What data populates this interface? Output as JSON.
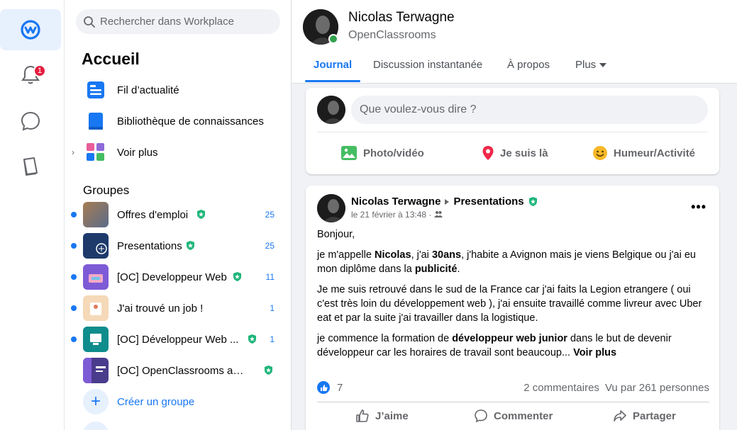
{
  "rail": {
    "notifications_badge": "1"
  },
  "sidebar": {
    "search_placeholder": "Rechercher dans Workplace",
    "title": "Accueil",
    "nav": [
      {
        "label": "Fil d’actualité",
        "icon": "news-feed-icon"
      },
      {
        "label": "Bibliothèque de connaissances",
        "icon": "knowledge-library-icon"
      },
      {
        "label": "Voir plus",
        "icon": "see-more-icon"
      }
    ],
    "groups_title": "Groupes",
    "groups": [
      {
        "name": "Offres d'emploi",
        "count": "25",
        "unread": true
      },
      {
        "name": "Presentations",
        "count": "25",
        "unread": true
      },
      {
        "name": "[OC] Developpeur Web",
        "count": "11",
        "unread": true
      },
      {
        "name": "J'ai trouvé un job !",
        "count": "1",
        "unread": true
      },
      {
        "name": "[OC] Développeur Web ...",
        "count": "1",
        "unread": true
      },
      {
        "name": "[OC] OpenClassrooms anno...",
        "count": "",
        "unread": false
      }
    ],
    "create_group": "Créer un groupe"
  },
  "profile": {
    "name": "Nicolas Terwagne",
    "org": "OpenClassrooms",
    "tabs": [
      "Journal",
      "Discussion instantanée",
      "À propos",
      "Plus"
    ]
  },
  "composer": {
    "placeholder": "Que voulez-vous dire ?",
    "actions": [
      "Photo/vidéo",
      "Je suis là",
      "Humeur/Activité"
    ]
  },
  "post": {
    "author": "Nicolas Terwagne",
    "group": "Presentations",
    "date": "le 21 février à 13:48 · ",
    "greeting": "Bonjour,",
    "p1_a": "je m'appelle ",
    "p1_b": "Nicolas",
    "p1_c": ", j'ai ",
    "p1_d": "30ans",
    "p1_e": ", j'habite a Avignon mais je viens Belgique ou j'ai eu mon diplôme dans la ",
    "p1_f": "publicité",
    "p1_g": ".",
    "p2": "Je me suis retrouvé dans le sud de la France car j'ai faits la Legion etrangere ( oui c'est très loin du développement web ), j'ai ensuite travaillé comme livreur avec Uber eat et par la suite j'ai travailler dans la logistique.",
    "p3_a": "je commence la formation de ",
    "p3_b": "développeur web junior",
    "p3_c": " dans le but de devenir développeur car les horaires de travail sont beaucoup... ",
    "see_more": "Voir plus",
    "likes": "7",
    "comments": "2 commentaires",
    "views": "Vu par 261 personnes",
    "actions": [
      "J’aime",
      "Commenter",
      "Partager"
    ]
  },
  "colors": {
    "accent": "#1877f2",
    "online": "#31a24c",
    "badge": "#e41e3f",
    "admin_shield": "#1fb57a"
  }
}
